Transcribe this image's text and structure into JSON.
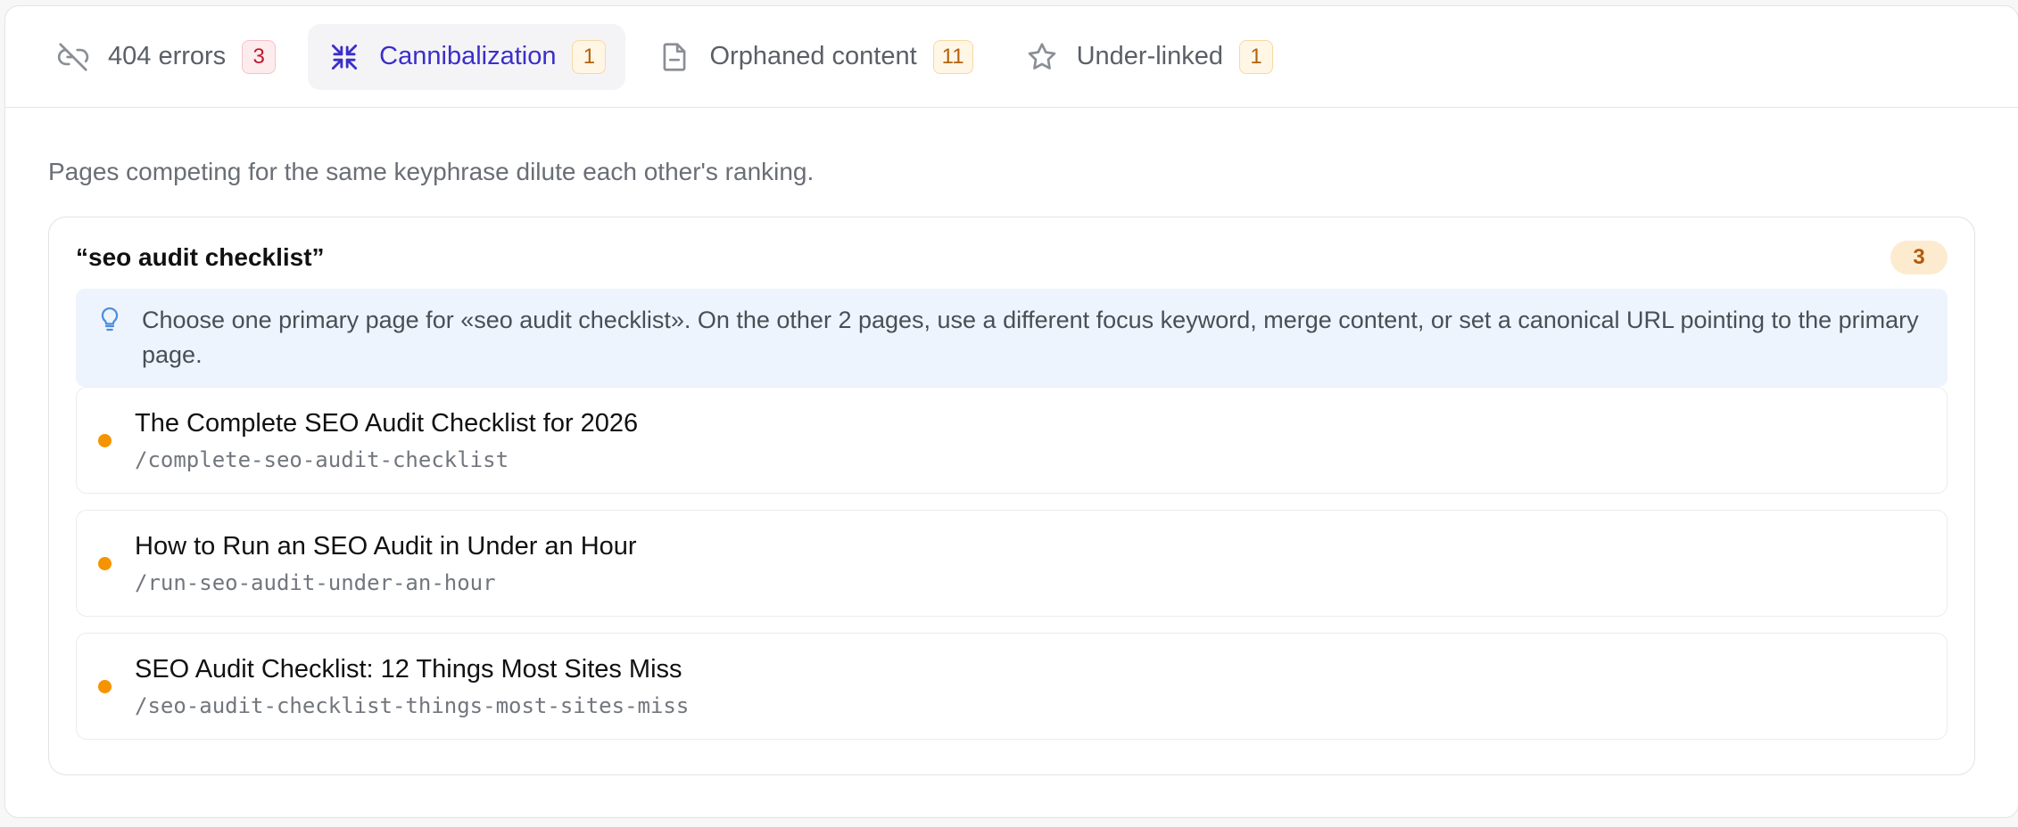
{
  "tabs": [
    {
      "label": "404 errors",
      "count": "3",
      "icon": "broken-link-icon"
    },
    {
      "label": "Cannibalization",
      "count": "1",
      "icon": "collapse-arrows-icon"
    },
    {
      "label": "Orphaned content",
      "count": "11",
      "icon": "document-icon"
    },
    {
      "label": "Under-linked",
      "count": "1",
      "icon": "star-icon"
    }
  ],
  "active_tab": "Cannibalization",
  "colors": {
    "accent": "#3b2fc9",
    "dot": "#f59300",
    "tip_bg": "#eef4fd"
  },
  "description": "Pages competing for the same keyphrase dilute each other's ranking.",
  "group": {
    "keyphrase": "“seo audit checklist”",
    "count": "3",
    "tip": "Choose one primary page for «seo audit checklist». On the other 2 pages, use a different focus keyword, merge content, or set a canonical URL pointing to the primary page.",
    "pages": [
      {
        "title": "The Complete SEO Audit Checklist for 2026",
        "url": "/complete-seo-audit-checklist"
      },
      {
        "title": "How to Run an SEO Audit in Under an Hour",
        "url": "/run-seo-audit-under-an-hour"
      },
      {
        "title": "SEO Audit Checklist: 12 Things Most Sites Miss",
        "url": "/seo-audit-checklist-things-most-sites-miss"
      }
    ]
  }
}
